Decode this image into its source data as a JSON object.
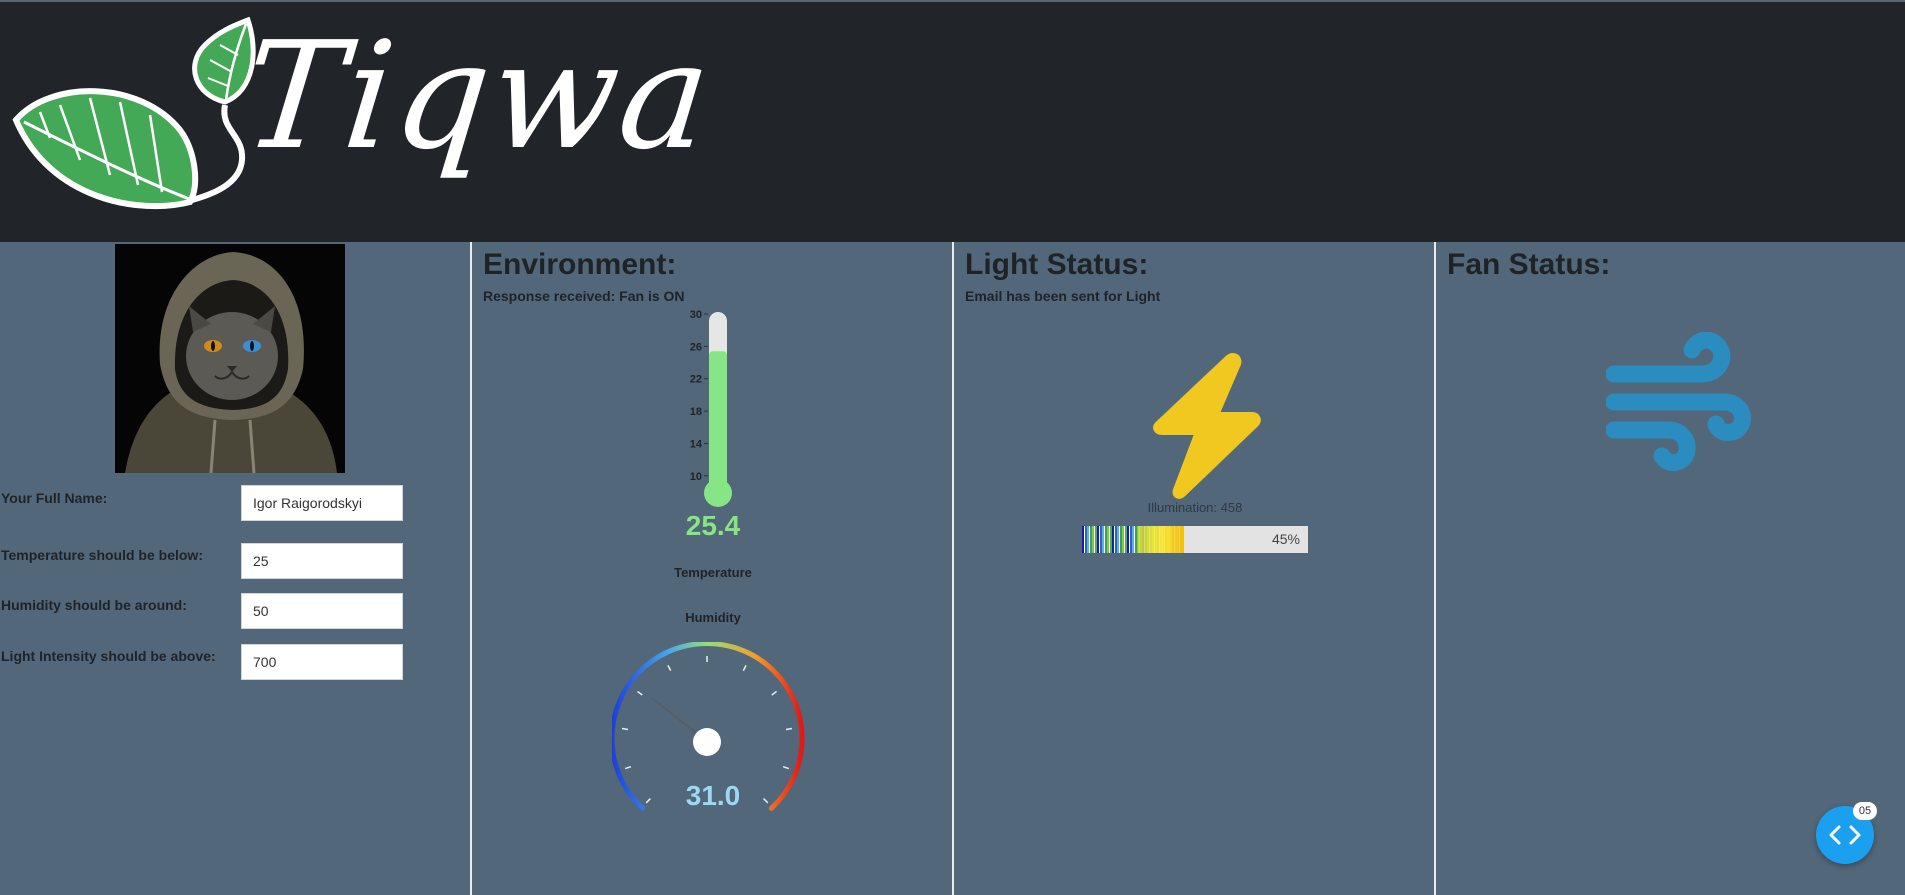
{
  "header": {
    "logo_text": "Tiqwa"
  },
  "profile": {
    "avatar": "hooded-cat-avatar"
  },
  "form": {
    "name_label": "Your Full Name:",
    "name_value": "Igor Raigorodskyi",
    "temp_label": "Temperature should be below:",
    "temp_value": "25",
    "humidity_label": "Humidity should be around:",
    "humidity_value": "50",
    "light_label": "Light Intensity should be above:",
    "light_value": "700"
  },
  "environment": {
    "title": "Environment:",
    "response": "Response received: Fan is ON",
    "temperature": {
      "label": "Temperature",
      "value": "25.4",
      "value_num": 25.4,
      "min": 8,
      "max": 30,
      "ticks": [
        "30",
        "26",
        "22",
        "18",
        "14",
        "10"
      ],
      "color": "#86e585"
    },
    "humidity": {
      "label": "Humidity",
      "value": "31.0",
      "value_num": 31.0,
      "min": 0,
      "max": 100,
      "color": "#9cd8f4"
    }
  },
  "light": {
    "title": "Light Status:",
    "status": "Email has been sent for Light",
    "icon": "lightning-bolt-icon",
    "icon_color": "#f0c820",
    "illumination_text": "Illumination: 458",
    "percent_label": "45%",
    "percent": 45
  },
  "fan": {
    "title": "Fan Status:",
    "icon": "wind-icon",
    "icon_color": "#2a8cbf"
  },
  "nav": {
    "icon": "code-nav-icon",
    "badge": "05"
  }
}
